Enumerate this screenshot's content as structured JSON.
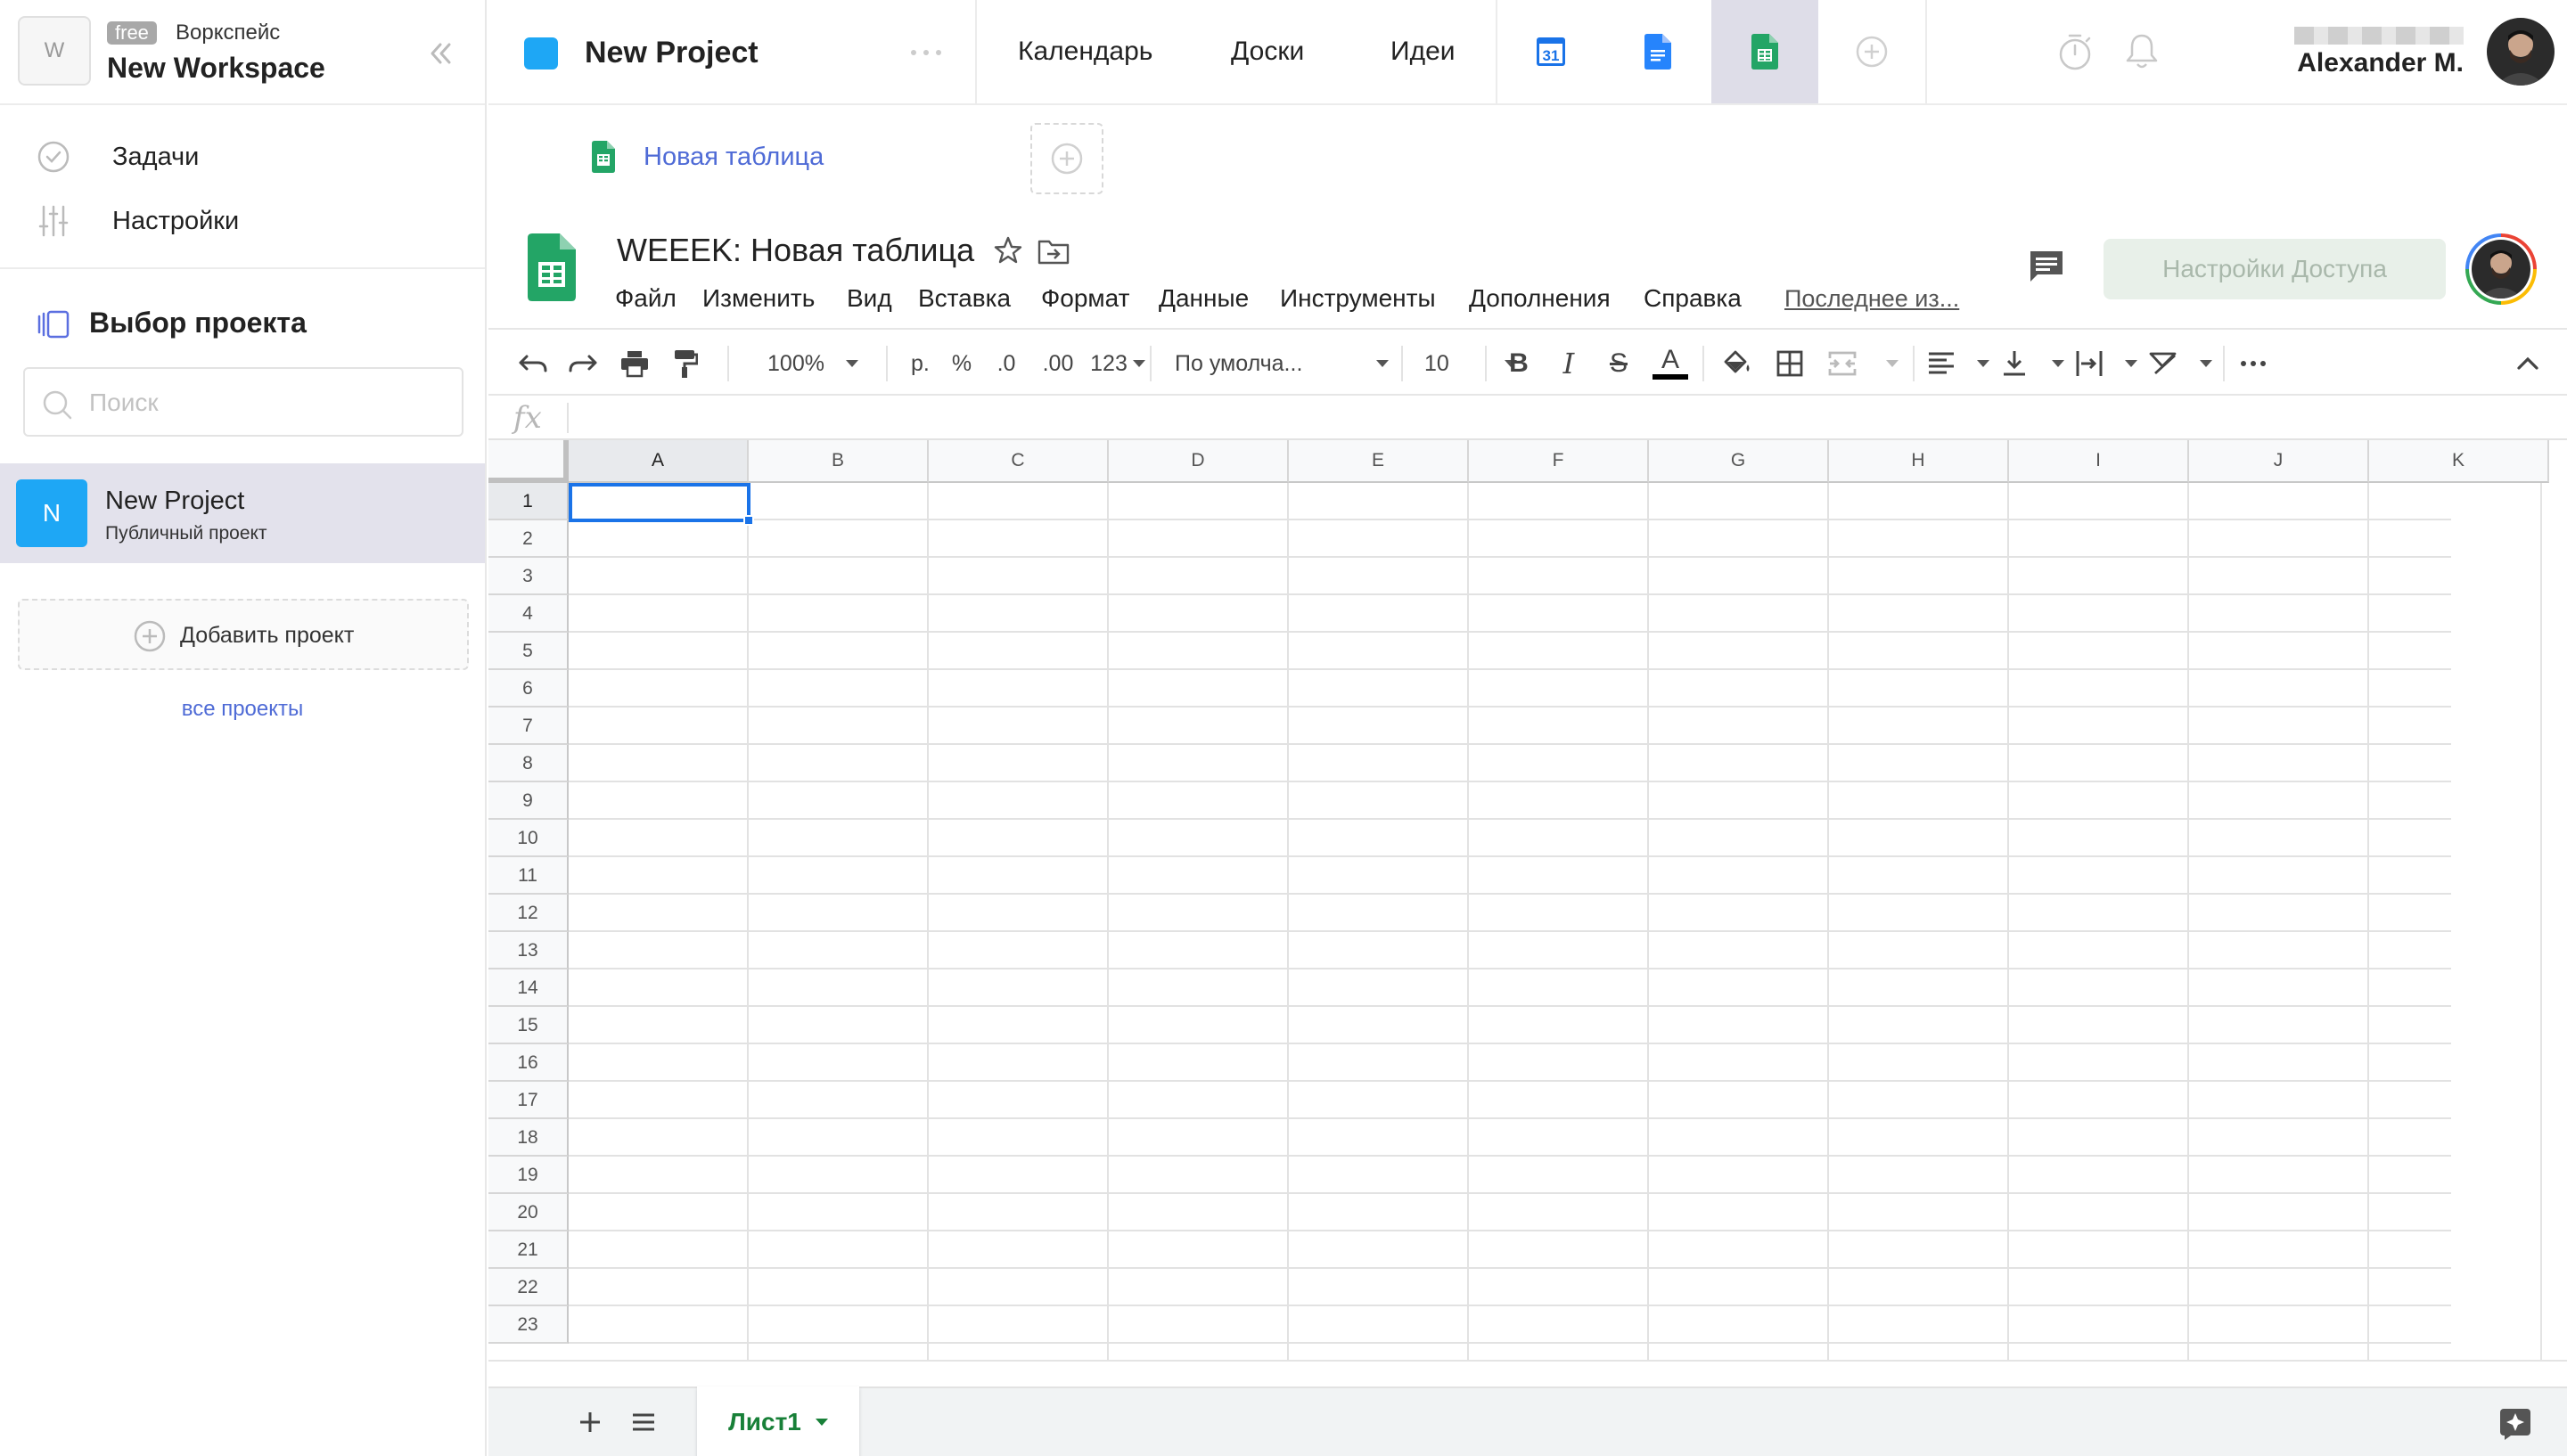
{
  "workspace": {
    "avatar_letter": "W",
    "plan_badge": "free",
    "type_label": "Воркспейс",
    "name": "New Workspace"
  },
  "sidebar": {
    "nav": [
      {
        "label": "Задачи",
        "icon": "check-circle-icon"
      },
      {
        "label": "Настройки",
        "icon": "sliders-icon"
      }
    ],
    "project_select_title": "Выбор проекта",
    "search_placeholder": "Поиск",
    "projects": [
      {
        "letter": "N",
        "name": "New Project",
        "subtitle": "Публичный проект",
        "color": "#1ea7f5"
      }
    ],
    "add_project_label": "Добавить проект",
    "all_projects_link": "все проекты"
  },
  "topbar": {
    "project_name": "New Project",
    "tabs": [
      "Календарь",
      "Доски",
      "Идеи"
    ],
    "apps": [
      "google-calendar-icon",
      "google-docs-icon",
      "google-sheets-icon",
      "add-circle-icon"
    ],
    "active_app": "google-sheets-icon",
    "user_name": "Alexander M.",
    "calendar_day": "31"
  },
  "doc_tabs": [
    {
      "label": "Новая таблица",
      "icon": "google-sheets-icon"
    }
  ],
  "sheets": {
    "title": "WEEEK: Новая таблица",
    "menu": [
      "Файл",
      "Изменить",
      "Вид",
      "Вставка",
      "Формат",
      "Данные",
      "Инструменты",
      "Дополнения",
      "Справка"
    ],
    "last_edit": "Последнее из...",
    "share_button": "Настройки Доступа",
    "toolbar": {
      "zoom": "100%",
      "currency": "р.",
      "percent": "%",
      "decrease_decimal": ".0",
      "increase_decimal": ".00",
      "number_format": "123",
      "font": "По умолча...",
      "font_size": "10",
      "bold": "B",
      "italic": "I",
      "strike": "S",
      "text_color": "A"
    },
    "fx_label": "fx",
    "columns": [
      "A",
      "B",
      "C",
      "D",
      "E",
      "F",
      "G",
      "H",
      "I",
      "J",
      "K"
    ],
    "rows": [
      "1",
      "2",
      "3",
      "4",
      "5",
      "6",
      "7",
      "8",
      "9",
      "10",
      "11",
      "12",
      "13",
      "14",
      "15",
      "16",
      "17",
      "18",
      "19",
      "20",
      "21",
      "22",
      "23"
    ],
    "sheet_tab": "Лист1"
  },
  "colors": {
    "accent_blue": "#1ea7f5",
    "link_blue": "#4f6bd6",
    "sheets_green": "#188038",
    "selection_blue": "#1a73e8"
  }
}
